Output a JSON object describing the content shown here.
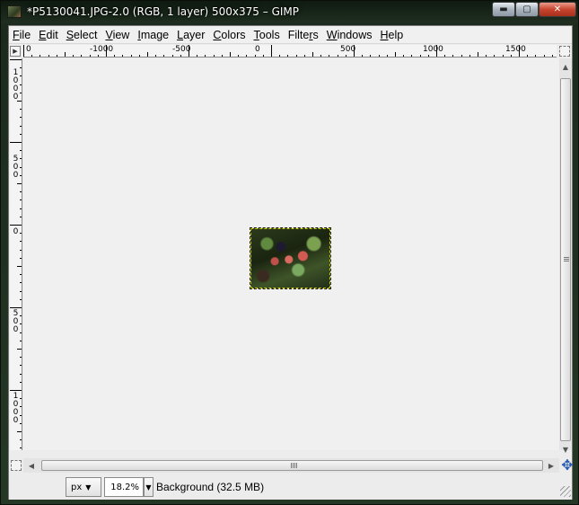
{
  "window": {
    "title": "*P5130041.JPG-2.0 (RGB, 1 layer) 500x375 – GIMP",
    "minimize_glyph": "▬",
    "maximize_glyph": "▢",
    "close_glyph": "✕"
  },
  "menu": {
    "items": [
      {
        "u": "F",
        "rest": "ile"
      },
      {
        "u": "E",
        "rest": "dit"
      },
      {
        "u": "S",
        "rest": "elect"
      },
      {
        "u": "V",
        "rest": "iew"
      },
      {
        "u": "I",
        "rest": "mage"
      },
      {
        "u": "L",
        "rest": "ayer"
      },
      {
        "u": "C",
        "rest": "olors"
      },
      {
        "u": "T",
        "rest": "ools"
      },
      {
        "pre": "Filte",
        "u": "r",
        "rest": "s"
      },
      {
        "u": "W",
        "rest": "indows"
      },
      {
        "u": "H",
        "rest": "elp"
      }
    ]
  },
  "ruler_top": {
    "labels": [
      "0",
      "-1000",
      "-500",
      "0",
      "500",
      "1000",
      "1500"
    ]
  },
  "ruler_left": {
    "labels": [
      "1000",
      "500",
      "0",
      "500",
      "1000"
    ]
  },
  "icons": {
    "menu_arrow": "▶",
    "scroll_up": "▲",
    "scroll_down": "▼",
    "scroll_left": "◀",
    "scroll_right": "▶",
    "navigate": "✥"
  },
  "status": {
    "unit": "px",
    "zoom": "18.2%",
    "message": "Background (32.5 MB)"
  },
  "colors": {
    "accent_navigate": "#2a5db0",
    "selection_outline": "#c8c800"
  }
}
